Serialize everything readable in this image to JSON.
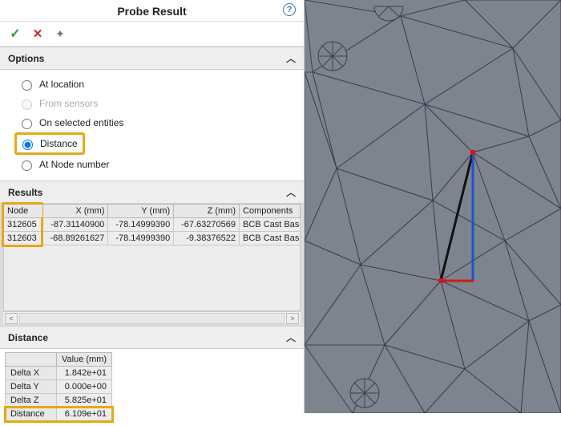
{
  "title": "Probe Result",
  "options": {
    "heading": "Options",
    "items": [
      {
        "id": "at-location",
        "label": "At location",
        "selected": false,
        "enabled": true
      },
      {
        "id": "from-sensors",
        "label": "From sensors",
        "selected": false,
        "enabled": false
      },
      {
        "id": "on-selected",
        "label": "On selected entities",
        "selected": false,
        "enabled": true
      },
      {
        "id": "distance",
        "label": "Distance",
        "selected": true,
        "enabled": true
      },
      {
        "id": "at-node-num",
        "label": "At Node number",
        "selected": false,
        "enabled": true
      }
    ]
  },
  "results": {
    "heading": "Results",
    "columns": [
      "Node",
      "X (mm)",
      "Y (mm)",
      "Z (mm)",
      "Components"
    ],
    "rows": [
      {
        "node": "312605",
        "x": "-87.31140900",
        "y": "-78.14999390",
        "z": "-67.63270569",
        "comp": "BCB Cast Base"
      },
      {
        "node": "312603",
        "x": "-68.89261627",
        "y": "-78.14999390",
        "z": "-9.38376522",
        "comp": "BCB Cast Base"
      }
    ]
  },
  "distance": {
    "heading": "Distance",
    "value_header": "Value (mm)",
    "rows": [
      {
        "label": "Delta X",
        "value": "1.842e+01"
      },
      {
        "label": "Delta Y",
        "value": "0.000e+00"
      },
      {
        "label": "Delta Z",
        "value": "5.825e+01"
      },
      {
        "label": "Distance",
        "value": "6.109e+01"
      }
    ]
  },
  "viewport": {
    "axes": {
      "x_color": "#d11919",
      "y_color": "#1953d1",
      "measure_color": "#111111"
    },
    "mesh_edge_color": "#3a3f53",
    "mesh_face_color": "#7e848e"
  }
}
